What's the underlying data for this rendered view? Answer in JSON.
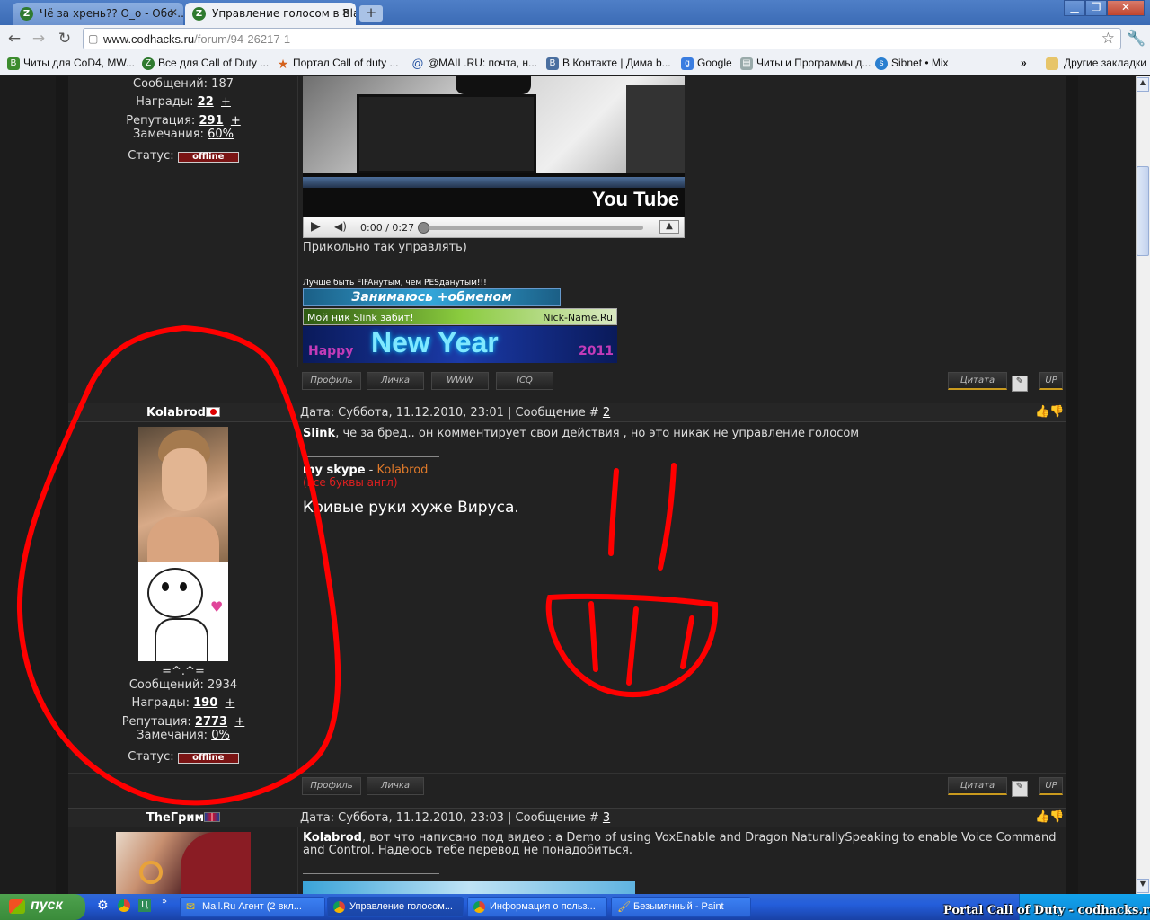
{
  "browser": {
    "tabs": [
      {
        "title": "Чё за хрень?? O_o - Обо ...",
        "active": false
      },
      {
        "title": "Управление голосом в Bla...",
        "active": true
      }
    ],
    "url_domain": "www.codhacks.ru",
    "url_path": "/forum/94-26217-1",
    "bookmarks": [
      "Читы для CoD4, MW...",
      "Все для Call of Duty ...",
      "Портал Call of duty ...",
      "@MAIL.RU: почта, н...",
      "В Контакте | Дима b...",
      "Google",
      "Читы и Программы д...",
      "Sibnet • Mix"
    ],
    "bookmarks_more": "»",
    "other_bookmarks": "Другие закладки"
  },
  "post1": {
    "messages_label": "Сообщений:",
    "messages_value": "187",
    "awards_label": "Награды:",
    "awards_value": "22",
    "plus": "+",
    "rep_label": "Репутация:",
    "rep_value": "291",
    "warn_label": "Замечания:",
    "warn_value": "60%",
    "status_label": "Статус:",
    "status_value": "offline",
    "video_time": "0:00 / 0:27",
    "youtube": "You Tube",
    "text": "Прикольно так управлять)",
    "sig_line": "Лучше быть FIFAнутым, чем PESданутым!!!",
    "banner1": "Занимаюсь +обменом",
    "banner2_left": "Мой ник Slink забит!",
    "banner2_right": "Nick-Name.Ru",
    "banner3": "New Year",
    "banner3_small1": "Happy",
    "banner3_small2": "2011",
    "buttons": [
      "Профиль",
      "Личка",
      "WWW",
      "ICQ"
    ],
    "quote": "Цитата",
    "up": "UP"
  },
  "post2": {
    "author": "Kolabrod",
    "header": "Дата: Суббота, 11.12.2010, 23:01 | Сообщение #",
    "post_num": "2",
    "text_bold": "Slink",
    "text": ", че за бред.. он комментирует свои действия , но это никак не управление голосом",
    "sig_bold": "my skype",
    "sig_dash": " - ",
    "sig_name": "Kolabrod",
    "sig_red": "(все буквы англ)",
    "sig_big": "Кривые руки хуже Вируса.",
    "avatar_caption": "=^.^=",
    "messages_label": "Сообщений:",
    "messages_value": "2934",
    "awards_label": "Награды:",
    "awards_value": "190",
    "plus": "+",
    "rep_label": "Репутация:",
    "rep_value": "2773",
    "warn_label": "Замечания:",
    "warn_value": "0%",
    "status_label": "Статус:",
    "status_value": "offline",
    "buttons": [
      "Профиль",
      "Личка"
    ],
    "quote": "Цитата",
    "up": "UP"
  },
  "post3": {
    "author": "TheГрим",
    "header": "Дата: Суббота, 11.12.2010, 23:03 | Сообщение #",
    "post_num": "3",
    "text_bold": "Kolabrod",
    "text": ", вот что написано под видео : a Demo of using VoxEnable and Dragon NaturallySpeaking to enable Voice Command and Control. Надеюсь тебе перевод не понадобиться."
  },
  "taskbar": {
    "start": "пуск",
    "items": [
      "Mail.Ru Агент (2 вкл...",
      "Управление голосом...",
      "Информация о польз...",
      "Безымянный - Paint"
    ],
    "watermark": "Portal Call of Duty - codhacks.ru"
  },
  "colors": {
    "annotation": "#ff0000",
    "status_offline": "#7a1414",
    "skype_name": "#e07a2a",
    "skype_note": "#e02020"
  }
}
